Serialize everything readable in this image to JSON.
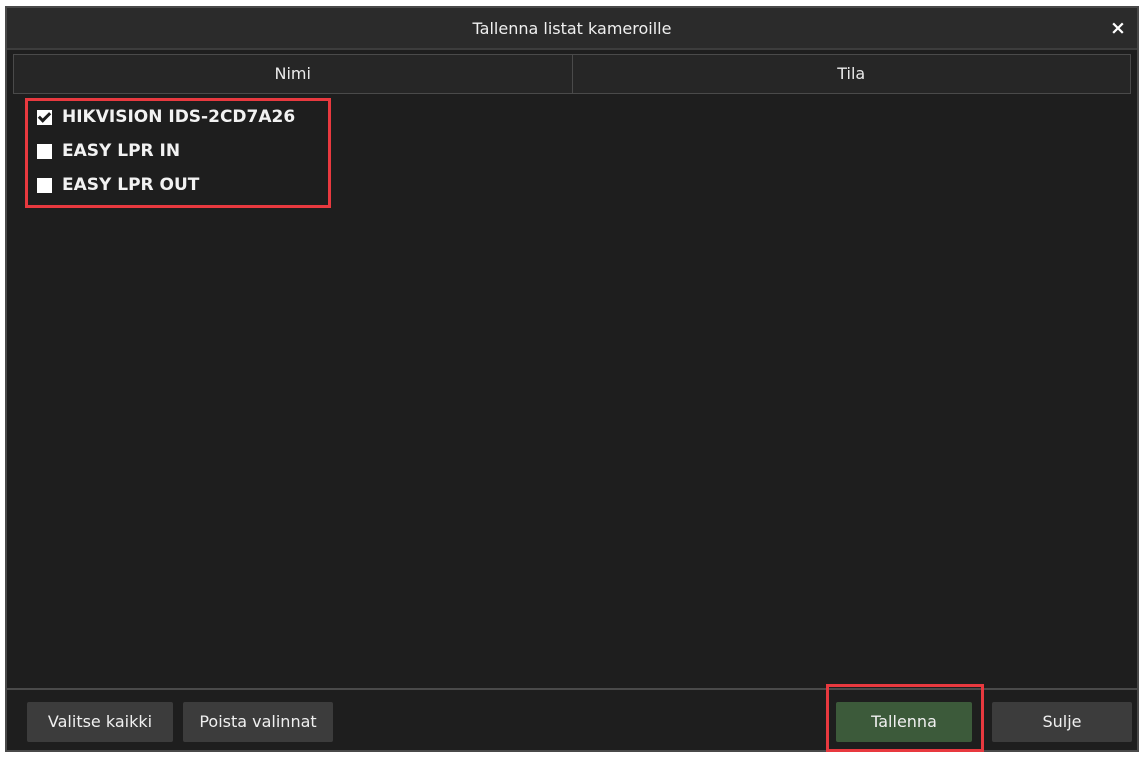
{
  "dialog": {
    "title": "Tallenna listat kameroille",
    "close_glyph": "×"
  },
  "table": {
    "columns": [
      "Nimi",
      "Tila"
    ]
  },
  "cameras": [
    {
      "name": "HIKVISION IDS-2CD7A26",
      "checked": true
    },
    {
      "name": "EASY LPR IN",
      "checked": false
    },
    {
      "name": "EASY LPR OUT",
      "checked": false
    }
  ],
  "footer": {
    "select_all": "Valitse kaikki",
    "clear_selection": "Poista valinnat",
    "save": "Tallenna",
    "close": "Sulje"
  },
  "colors": {
    "background": "#1e1e1e",
    "save_button": "#3c5a3a",
    "highlight": "#e8393f"
  }
}
